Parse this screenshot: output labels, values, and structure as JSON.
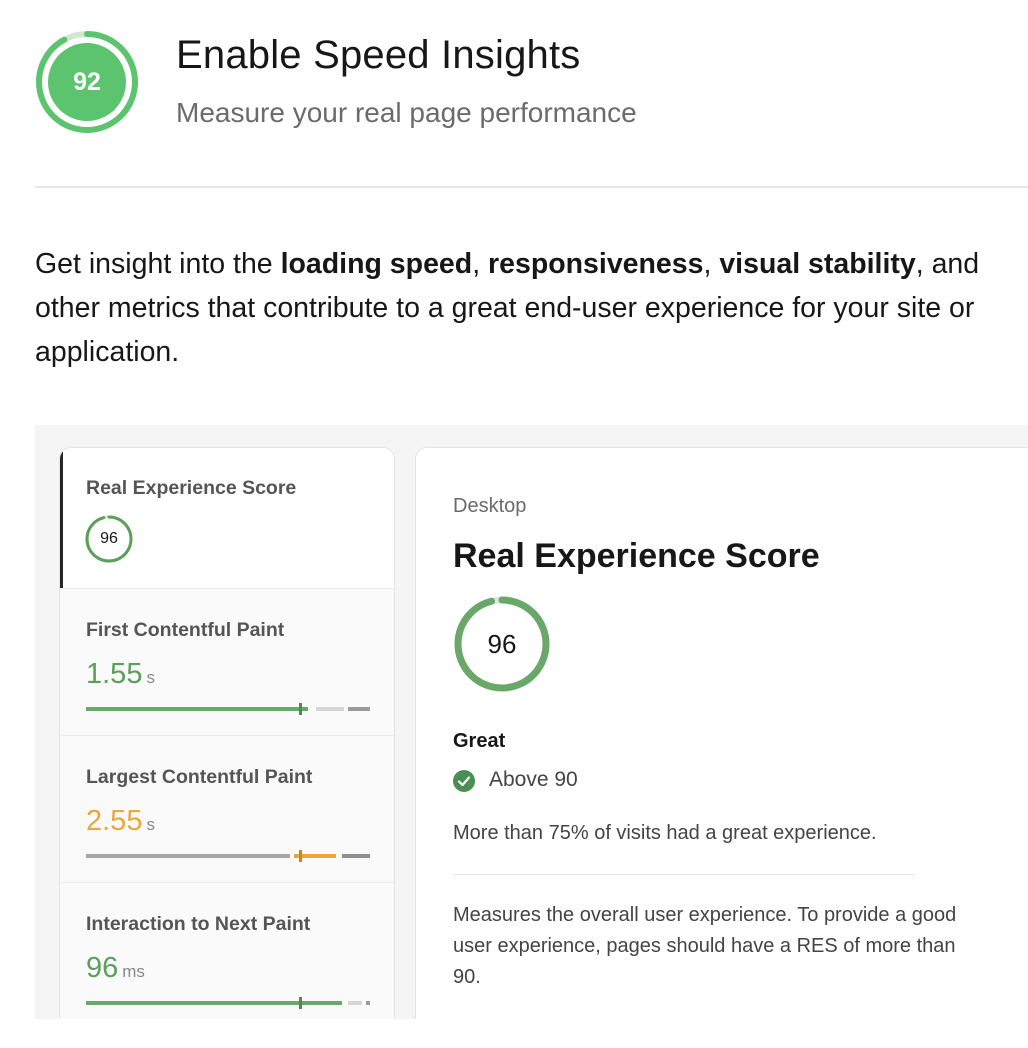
{
  "header": {
    "score": "92",
    "score_fraction": 0.92,
    "title": "Enable Speed Insights",
    "subtitle": "Measure your real page performance"
  },
  "intro": {
    "part1": "Get insight into the ",
    "bold1": "loading speed",
    "sep1": ", ",
    "bold2": "responsiveness",
    "sep2": ", ",
    "bold3": "visual stability",
    "part2": ", and other metrics that contribute to a great end-user experience for your site or application."
  },
  "metrics": [
    {
      "label": "Real Experience Score",
      "score": "96",
      "score_fraction": 0.96,
      "active": true
    },
    {
      "label": "First Contentful Paint",
      "value": "1.55",
      "unit": "s",
      "color": "#5aa05a",
      "position": 0.76
    },
    {
      "label": "Largest Contentful Paint",
      "value": "2.55",
      "unit": "s",
      "color": "#e8a93a",
      "position": 0.8
    },
    {
      "label": "Interaction to Next Paint",
      "value": "96",
      "unit": "ms",
      "color": "#5aa05a",
      "position": 0.76
    }
  ],
  "detail": {
    "device": "Desktop",
    "title": "Real Experience Score",
    "score": "96",
    "score_fraction": 0.96,
    "status": "Great",
    "threshold": "Above 90",
    "note": "More than 75% of visits had a great experience.",
    "description": "Measures the overall user experience. To provide a good user experience, pages should have a RES of more than 90."
  },
  "colors": {
    "accent_green": "#5cc46e",
    "ring_green": "#6aa86a",
    "check_green": "#4a8f52",
    "warning_orange": "#e8a93a"
  }
}
